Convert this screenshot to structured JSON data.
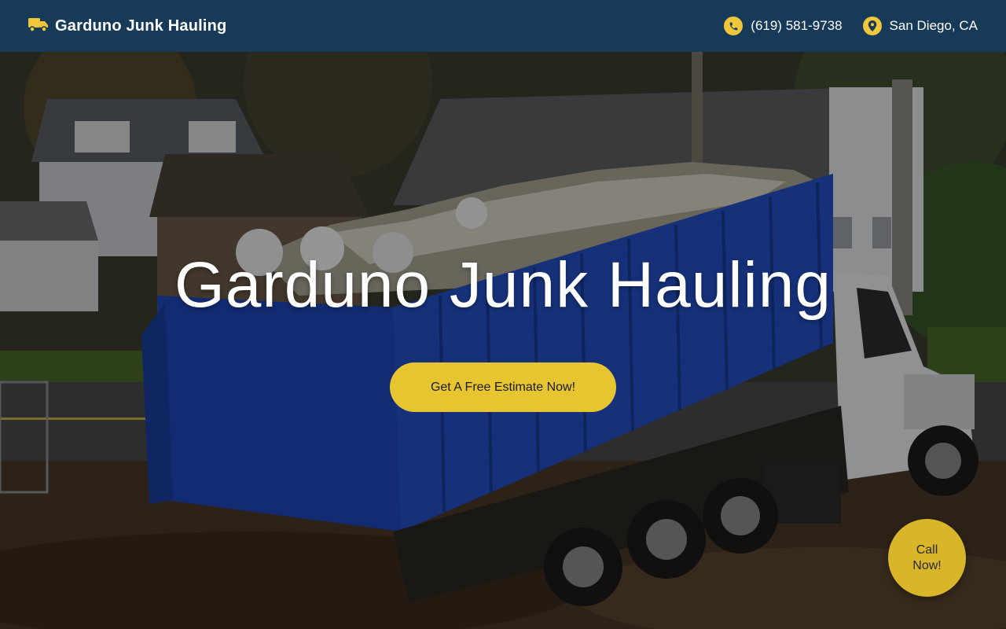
{
  "header": {
    "brand_name": "Garduno Junk Hauling",
    "brand_icon": "truck-icon",
    "phone": "(619) 581-9738",
    "phone_icon": "phone-icon",
    "location": "San Diego, CA",
    "location_icon": "map-pin-icon",
    "accent_color": "#f0c63a",
    "background_color": "#173a59"
  },
  "hero": {
    "title": "Garduno Junk Hauling",
    "cta_label": "Get A Free Estimate Now!",
    "cta_color": "#e6c530",
    "background_image": "roll-off dumpster truck loaded with debris in front of houses"
  },
  "floating_button": {
    "label": "Call Now!",
    "color": "#d9b52a"
  }
}
